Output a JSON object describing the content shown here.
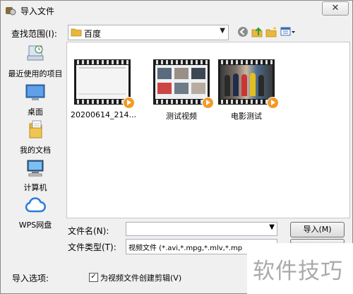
{
  "window": {
    "title": "导入文件",
    "close_label": "✕"
  },
  "lookin": {
    "label": "查找范围(I):",
    "value": "百度"
  },
  "toolbar": {
    "back_icon": "back-icon",
    "up_icon": "up-folder-icon",
    "new_folder_icon": "new-folder-icon",
    "views_icon": "views-menu-icon"
  },
  "places": [
    {
      "label": "最近使用的项目",
      "icon": "recent-items-icon"
    },
    {
      "label": "桌面",
      "icon": "desktop-icon"
    },
    {
      "label": "我的文档",
      "icon": "documents-icon"
    },
    {
      "label": "计算机",
      "icon": "computer-icon"
    },
    {
      "label": "WPS网盘",
      "icon": "cloud-icon"
    }
  ],
  "files": [
    {
      "name": "20200614_214..."
    },
    {
      "name": "测试视频"
    },
    {
      "name": "电影测试"
    }
  ],
  "filename": {
    "label": "文件名(N):",
    "value": ""
  },
  "filetype": {
    "label": "文件类型(T):",
    "value": "视频文件 (*.avi,*.mpg,*.mlv,*.mp"
  },
  "buttons": {
    "import": "导入(M)"
  },
  "options": {
    "label": "导入选项:",
    "checkbox_label": "为视频文件创建剪辑(V)",
    "checked": true
  },
  "watermark": {
    "text": "软件技巧"
  },
  "colors": {
    "play_badge": "#f29a28",
    "folder": "#e8b73c",
    "cloud": "#2a7bdc"
  }
}
